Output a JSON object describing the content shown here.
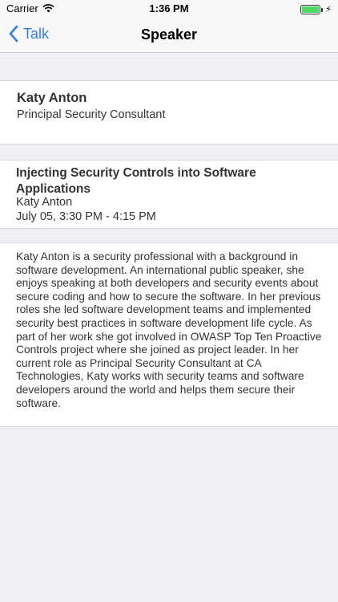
{
  "status_bar": {
    "carrier": "Carrier",
    "time": "1:36 PM",
    "battery_level": 1.0,
    "battery_color": "#4cd964"
  },
  "nav": {
    "back_label": "Talk",
    "title": "Speaker",
    "accent_color": "#2f7cf6"
  },
  "speaker": {
    "name": "Katy Anton",
    "title": "Principal Security Consultant"
  },
  "talk": {
    "title": "Injecting Security Controls into Software Applications",
    "speaker": "Katy Anton",
    "time": "July 05, 3:30 PM - 4:15 PM"
  },
  "bio": {
    "text": "Katy Anton is a security professional with a background in software development. An international public speaker, she enjoys speaking at both developers and security events about secure coding and how to secure the software. In her previous roles she led software development teams and implemented security best practices in software development life cycle. As part of her work she got involved in OWASP Top Ten Proactive Controls project where she joined as project leader. In her current role as Principal Security Consultant at CA Technologies, Katy works with security teams and software developers around the world and helps them secure their software."
  },
  "icons": {
    "wifi": "wifi-icon",
    "battery": "battery-icon",
    "charging": "charging-bolt-icon",
    "back": "chevron-left-icon"
  }
}
